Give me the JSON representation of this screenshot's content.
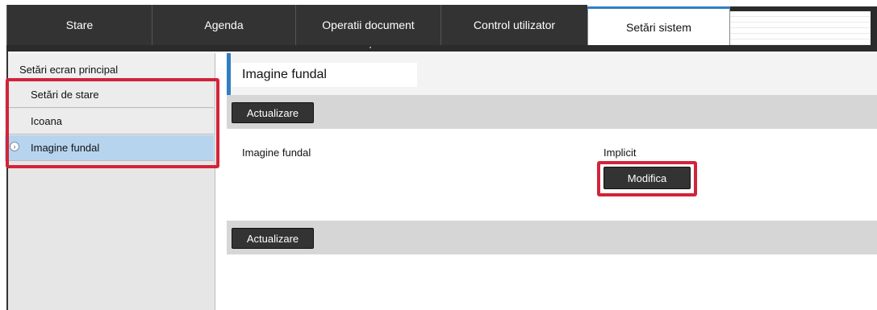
{
  "tabs": [
    {
      "label": "Stare"
    },
    {
      "label": "Agenda"
    },
    {
      "label": "Operatii document"
    },
    {
      "label": "Control utilizator"
    },
    {
      "label": "Setări sistem"
    }
  ],
  "sidebar": {
    "heading": "Setări ecran principal",
    "items": [
      {
        "label": "Setări de stare"
      },
      {
        "label": "Icoana"
      },
      {
        "label": "Imagine fundal"
      }
    ]
  },
  "main": {
    "title": "Imagine fundal",
    "update_top_label": "Actualizare",
    "update_bottom_label": "Actualizare",
    "setting_label": "Imagine fundal",
    "setting_value": "Implicit",
    "modify_label": "Modifica"
  },
  "colors": {
    "accent": "#2f7fc1",
    "highlight_red": "#d1243a",
    "active_sidebar": "#b7d4ef"
  }
}
